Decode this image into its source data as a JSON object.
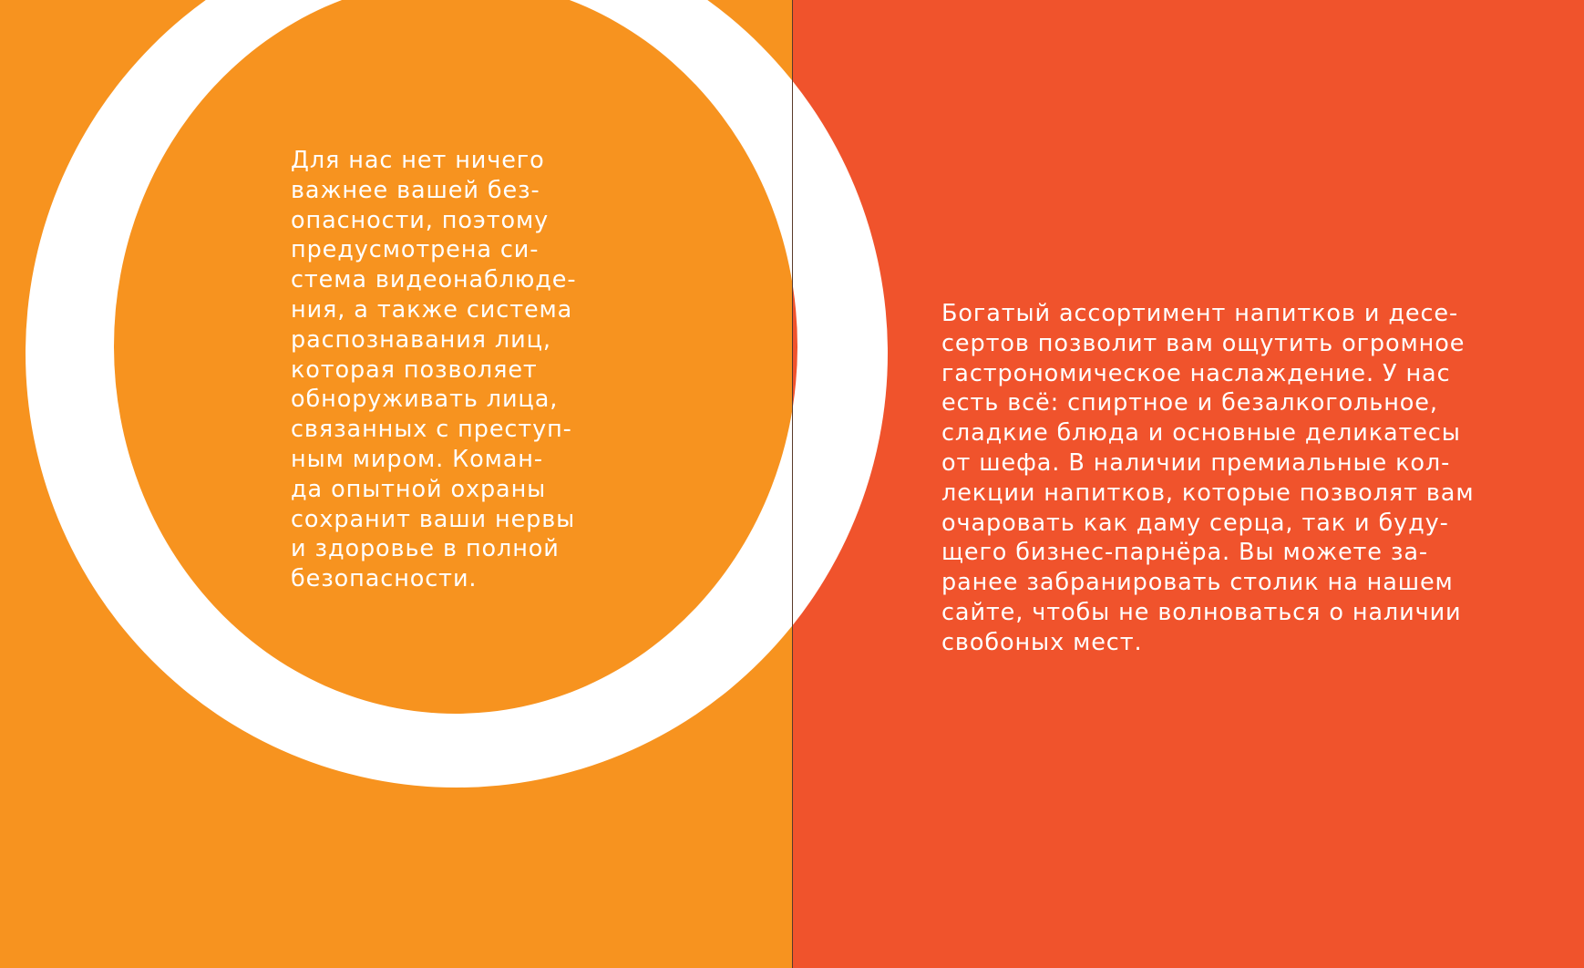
{
  "palette": {
    "left_panel": "#F7931F",
    "right_panel": "#F0532C",
    "ring": "#FFFFFF",
    "text": "#FFFFFF"
  },
  "security_text": "Для нас нет ничего\nважнее вашей без-\nопасности, поэтому\nпредусмотрена си-\nстема видеонаблюде-\nния, а также система\nраспознавания лиц,\nкоторая позволяет\nобноруживать лица,\nсвязанных с преступ-\nным миром. Коман-\nда опытной охраны\nсохранит ваши нервы\nи здоровье в полной\nбезопасности.",
  "menu_text": "Богатый ассортимент напитков и десе-\nсертов позволит вам ощутить огромное\nгастрономическое наслаждение. У нас\nесть всё: спиртное и безалкогольное,\nсладкие блюда и основные деликатесы\nот шефа. В наличии премиальные кол-\nлекции напитков, которые позволят вам\nочаровать как даму серца, так и буду-\nщего бизнес-парнёра. Вы можете за-\nранее забранировать столик на нашем\nсайте, чтобы не волноваться о наличии\nсвобоных мест."
}
